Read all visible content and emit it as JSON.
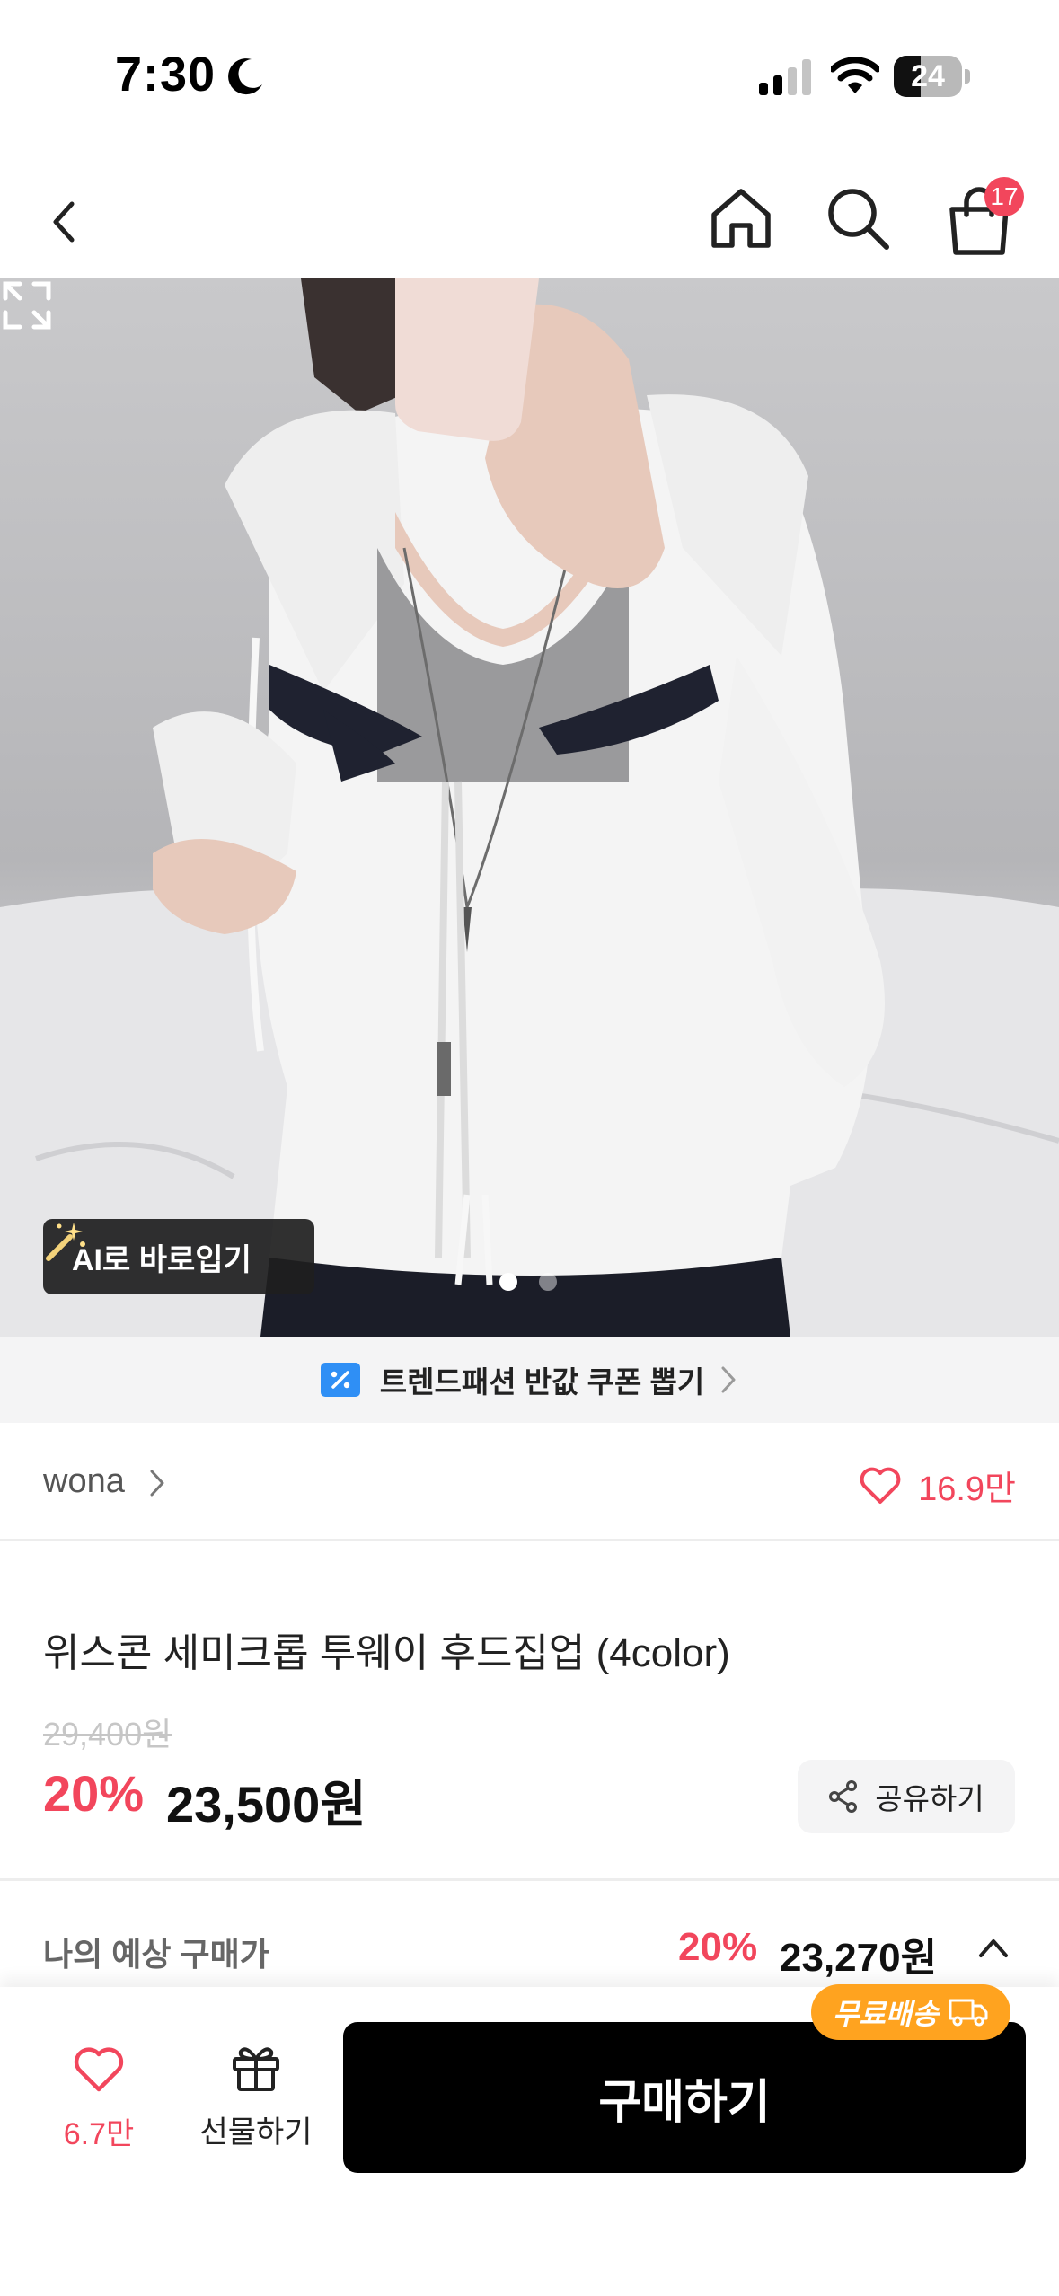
{
  "status_bar": {
    "time": "7:30",
    "battery": "24"
  },
  "nav": {
    "cart_badge": "17"
  },
  "hero": {
    "ai_button_label": "AI로 바로입기",
    "page_count": 2,
    "current_page": 1
  },
  "coupon_banner": {
    "label": "트렌드패션 반값 쿠폰 뽑기"
  },
  "brand": {
    "name": "wona",
    "like_count": "16.9만"
  },
  "product": {
    "title": "위스콘 세미크롭 투웨이 후드집업 (4color)",
    "original_price": "29,400원",
    "discount_rate": "20%",
    "sale_price": "23,500원",
    "share_label": "공유하기"
  },
  "estimate": {
    "label": "나의 예상 구매가",
    "discount_rate": "20%",
    "price": "23,270원"
  },
  "bottom_bar": {
    "wish_count": "6.7만",
    "gift_label": "선물하기",
    "buy_label": "구매하기",
    "free_shipping_label": "무료배송"
  },
  "colors": {
    "accent": "#f2465c",
    "buy_button": "#000000",
    "free_shipping": "#ffa31f"
  }
}
